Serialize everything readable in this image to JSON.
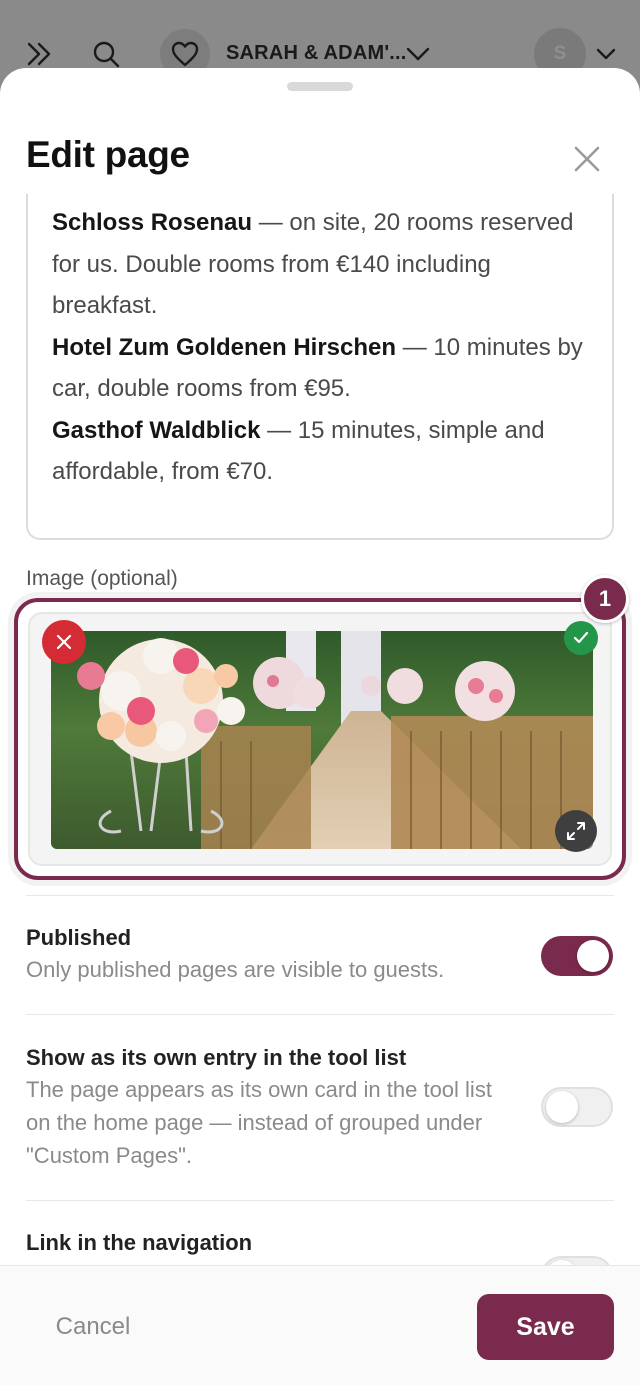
{
  "app_bar": {
    "couple_name": "SARAH & ADAM'...",
    "avatar_initial": "S"
  },
  "sheet": {
    "title": "Edit page",
    "content": {
      "entries": [
        {
          "name": "Schloss Rosenau",
          "detail": " — on site, 20 rooms reserved for us. Double rooms from €140 including breakfast."
        },
        {
          "name": "Hotel Zum Goldenen Hirschen",
          "detail": " — 10 minutes by car, double rooms from €95."
        },
        {
          "name": "Gasthof Waldblick",
          "detail": " — 15 minutes, simple and affordable, from €70."
        }
      ]
    },
    "image": {
      "label": "Image (optional)",
      "badge": "1"
    },
    "settings": [
      {
        "title": "Published",
        "description": "Only published pages are visible to guests.",
        "enabled": true
      },
      {
        "title": "Show as its own entry in the tool list",
        "description": "The page appears as its own card in the tool list on the home page — instead of grouped under \"Custom Pages\".",
        "enabled": false
      },
      {
        "title": "Link in the navigation",
        "description": "",
        "enabled": false
      }
    ]
  },
  "footer": {
    "cancel_label": "Cancel",
    "save_label": "Save"
  },
  "colors": {
    "brand": "#7a2a4c",
    "danger": "#d42b34",
    "success": "#24964a"
  },
  "icons": [
    "expand-menu-icon",
    "search-icon",
    "heart-icon",
    "chevron-down-icon",
    "close-icon",
    "remove-icon",
    "check-icon",
    "expand-icon"
  ]
}
